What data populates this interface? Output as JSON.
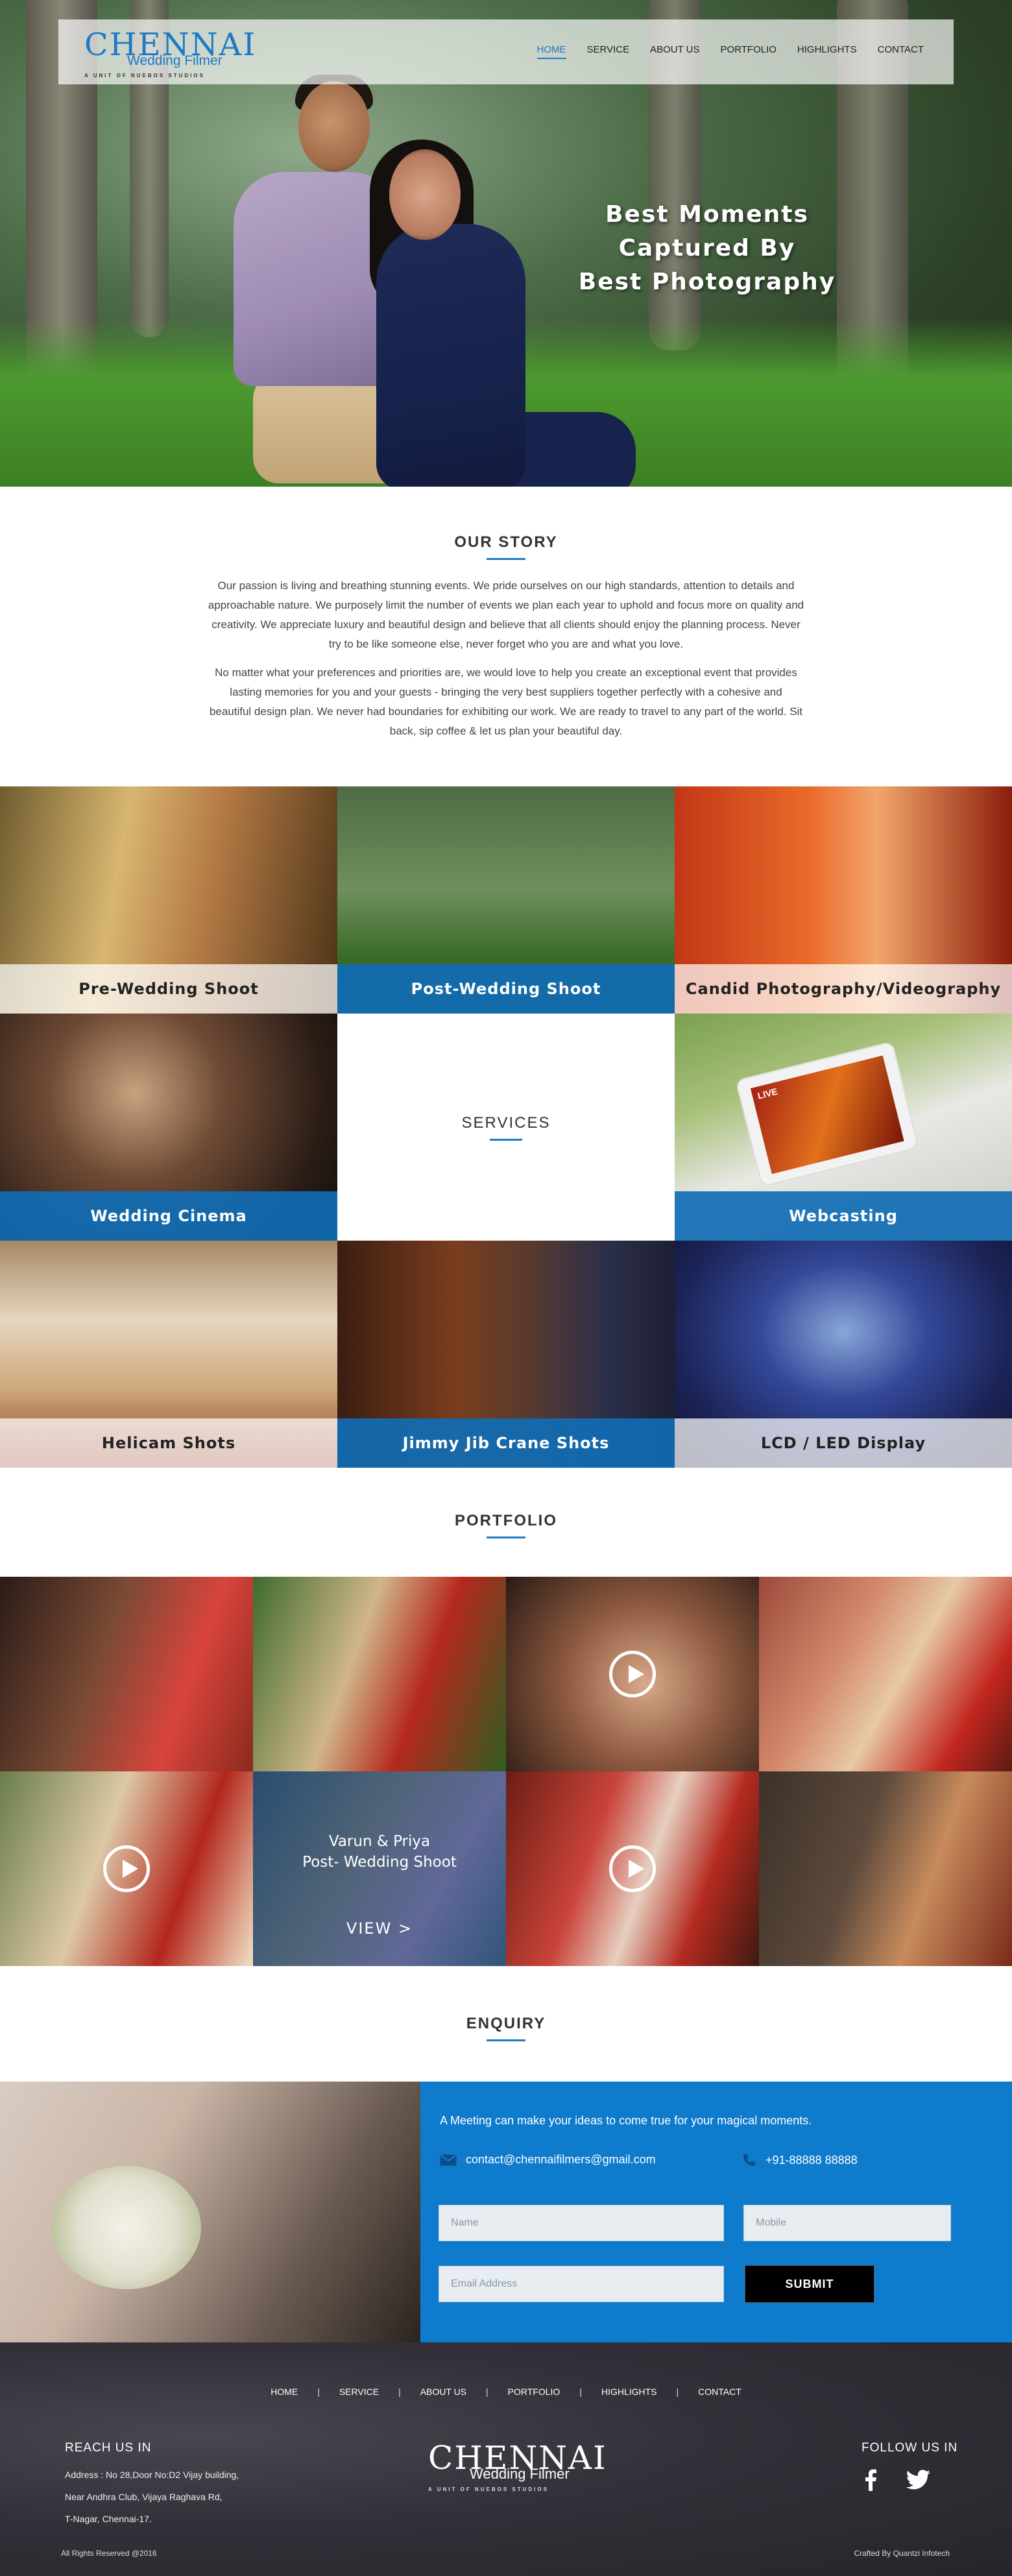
{
  "nav": {
    "logo_word": "CHENNAI",
    "logo_sub": "Wedding Filmer",
    "logo_tag": "A UNIT OF NUEBOS STUDIOS",
    "items": [
      "HOME",
      "SERVICE",
      "ABOUT US",
      "PORTFOLIO",
      "HIGHLIGHTS",
      "CONTACT"
    ],
    "active": "HOME"
  },
  "hero": {
    "tagline_line1": "Best Moments Captured By",
    "tagline_line2": "Best Photography"
  },
  "story": {
    "title": "OUR STORY",
    "paragraph1": "Our passion is living and breathing stunning events. We pride ourselves on our high standards, attention to details and approachable nature. We purposely limit the number of events we plan each year to uphold and focus more on quality and creativity. We appreciate luxury and beautiful design and believe that all clients should enjoy the planning process. Never try to be like someone else, never forget who you are and what you love.",
    "paragraph2": "No matter what your preferences and priorities are, we would love to help you create an exceptional event that provides lasting memories for you and your guests - bringing the very best suppliers together perfectly with a cohesive and beautiful design plan. We never had boundaries for exhibiting our work. We are ready to travel to any part of the world. Sit back, sip coffee & let us plan your beautiful day."
  },
  "services": {
    "title": "SERVICES",
    "tiles": [
      {
        "label": "Pre-Wedding Shoot",
        "style": "light"
      },
      {
        "label": "Post-Wedding Shoot",
        "style": "blue"
      },
      {
        "label": "Candid Photography/Videography",
        "style": "light"
      },
      {
        "label": "Wedding Cinema",
        "style": "blue"
      },
      {
        "label": "Webcasting",
        "style": "blue"
      },
      {
        "label": "Helicam Shots",
        "style": "light"
      },
      {
        "label": "Jimmy Jib Crane Shots",
        "style": "blue"
      },
      {
        "label": "LCD / LED Display",
        "style": "light"
      }
    ],
    "webcast_badge": "LIVE"
  },
  "portfolio": {
    "title": "PORTFOLIO",
    "overlay_line1": "Varun & Priya",
    "overlay_line2": "Post- Wedding Shoot",
    "overlay_view": "VIEW  >"
  },
  "enquiry": {
    "title": "ENQUIRY",
    "message": "A Meeting can make your ideas to come true for your magical moments.",
    "email": "contact@chennaifilmers@gmail.com",
    "phone": "+91-88888 88888",
    "name_placeholder": "Name",
    "mobile_placeholder": "Mobile",
    "email_placeholder": "Email Address",
    "submit_label": "SUBMIT"
  },
  "footer": {
    "menu": [
      "HOME",
      "SERVICE",
      "ABOUT US",
      "PORTFOLIO",
      "HIGHLIGHTS",
      "CONTACT"
    ],
    "separator": "|",
    "reach_title": "REACH US IN",
    "address_line1": "Address : No 28,Door No:D2 Vijay building,",
    "address_line2": "Near Andhra Club, Vijaya Raghava Rd,",
    "address_line3": "T-Nagar, Chennai-17.",
    "logo_word": "CHENNAI",
    "logo_sub": "Wedding Filmer",
    "logo_tag": "A UNIT OF NUEBOS STUDIOS",
    "follow_title": "FOLLOW US IN",
    "copyright": "All Rights Reserved @2016",
    "credit": "Crafted By Quantzi Infotech"
  },
  "colors": {
    "accent": "#1d7ac5",
    "enquiry_panel": "#0f7bcc",
    "footer_bg": "#2f2c34"
  },
  "icons": [
    "mail-icon",
    "phone-icon",
    "facebook-icon",
    "twitter-icon",
    "play-icon"
  ]
}
